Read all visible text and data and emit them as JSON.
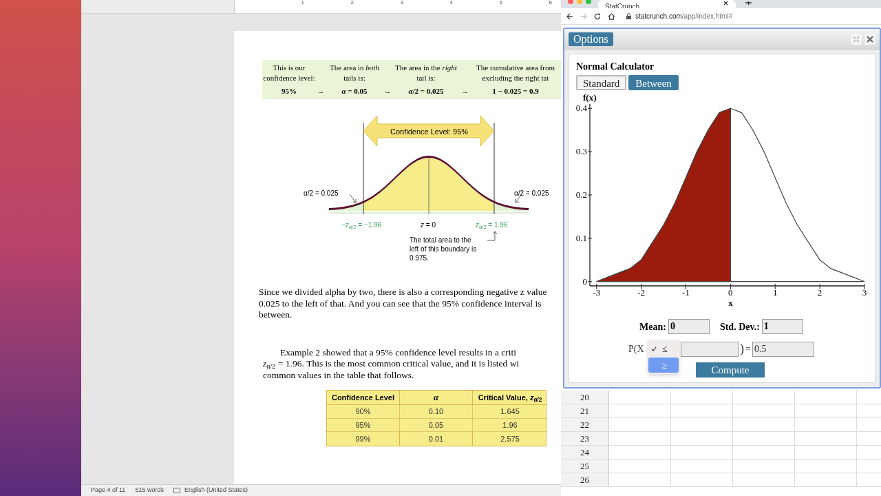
{
  "word": {
    "ruler_marks": [
      "1",
      "2",
      "3",
      "4",
      "5",
      "6"
    ],
    "summary_box": {
      "columns": [
        {
          "heading": [
            "This is our",
            "confidence level:"
          ],
          "value": "95%"
        },
        {
          "heading": [
            "The area in *both*",
            "tails is:"
          ],
          "value": "*α* = 0.05"
        },
        {
          "heading": [
            "The area in the *right*",
            "tail is:"
          ],
          "value": "*α*/2 = 0.025"
        },
        {
          "heading": [
            "The cumulative area from",
            "excluding the right tai"
          ],
          "value": "1 − 0.025 = 0.9"
        }
      ],
      "arrows": [
        "→",
        "→",
        "→"
      ]
    },
    "diagram": {
      "banner": "Confidence Level: 95%",
      "left_tail": "α/2 = 0.025",
      "right_tail": "α/2 = 0.025",
      "left_bound": "−*z*$_{α/2}$ = −1.96",
      "center": "*z* = 0",
      "right_bound": "*z*$_{α/2}$ = 1.96",
      "note": "The total area to the left of this boundary is 0.975."
    },
    "paragraphs": [
      {
        "indent": false,
        "lines": [
          "Since we divided alpha by two, there is also a corresponding negative z value",
          "0.025 to the left of that.  And you can see that the 95% confidence interval is",
          "between."
        ]
      },
      {
        "indent": true,
        "lines": [
          "Example 2 showed that a 95% confidence level results in a criti",
          "*z*$_{α/2}$ = 1.96. This is the most common critical value, and it is listed wi",
          "common values in the table that follows."
        ]
      }
    ],
    "table": {
      "columns": [
        "Confidence Level",
        "*α*",
        "Critical Value, *z*$_{α/2}$"
      ],
      "rows": [
        [
          "90%",
          "0.10",
          "1.645"
        ],
        [
          "95%",
          "0.05",
          "1.96"
        ],
        [
          "99%",
          "0.01",
          "2.575"
        ]
      ]
    },
    "status_bar": [
      "Page 4 of 11",
      "515 words",
      "English (United States)"
    ]
  },
  "browser": {
    "tab_title": "StatCrunch",
    "forward_disabled": true,
    "url_domain": "statcrunch.com",
    "url_path": "/app/index.html#"
  },
  "calculator": {
    "options_button": "Options",
    "heading": "Normal Calculator",
    "modes": [
      {
        "label": "Standard",
        "selected": true
      },
      {
        "label": "Between",
        "selected": false
      }
    ],
    "chart_data": {
      "type": "area",
      "xlabel": "x",
      "ylabel": "f(x)",
      "x": [
        -3,
        -2.75,
        -2.5,
        -2.25,
        -2,
        -1.75,
        -1.5,
        -1.25,
        -1,
        -0.75,
        -0.5,
        -0.25,
        0,
        0.25,
        0.5,
        0.75,
        1,
        1.25,
        1.5,
        1.75,
        2,
        2.25,
        2.5,
        2.75,
        3
      ],
      "series": [
        {
          "color": "#ffffff",
          "values": [
            0,
            0.01,
            0.02,
            0.03,
            0.05,
            0.09,
            0.13,
            0.18,
            0.24,
            0.3,
            0.35,
            0.39,
            0.4,
            0.39,
            0.35,
            0.3,
            0.24,
            0.18,
            0.13,
            0.09,
            0.05,
            0.03,
            0.02,
            0.01,
            0
          ]
        },
        {
          "color": "#9b1c0c",
          "values": [
            0,
            0.01,
            0.02,
            0.03,
            0.05,
            0.09,
            0.13,
            0.18,
            0.24,
            0.3,
            0.35,
            0.39,
            0.4,
            null,
            null,
            null,
            null,
            null,
            null,
            null,
            null,
            null,
            null,
            null,
            null
          ]
        }
      ],
      "xlim": [
        -3.15,
        3
      ],
      "ylim": [
        -0.01,
        0.41
      ],
      "xticks": [
        -3,
        -2,
        -1,
        0,
        1,
        2,
        3
      ],
      "yticks": [
        0,
        0.1,
        0.2,
        0.3,
        0.4
      ],
      "stacked": false
    },
    "mean": {
      "label": "Mean:",
      "value": "0"
    },
    "std_dev": {
      "label": "Std. Dev.:",
      "value": "1"
    },
    "probability": {
      "prefix": "P(X",
      "suffix": ")",
      "equals": "=",
      "result": "0.5"
    },
    "operator_menu": [
      {
        "label": "≤",
        "checked": true,
        "highlighted": false
      },
      {
        "label": "≥",
        "checked": false,
        "highlighted": true
      }
    ],
    "compute_button": "Compute"
  },
  "spreadsheet": {
    "row_numbers": [
      "20",
      "21",
      "22",
      "23",
      "24",
      "25",
      "26"
    ]
  }
}
